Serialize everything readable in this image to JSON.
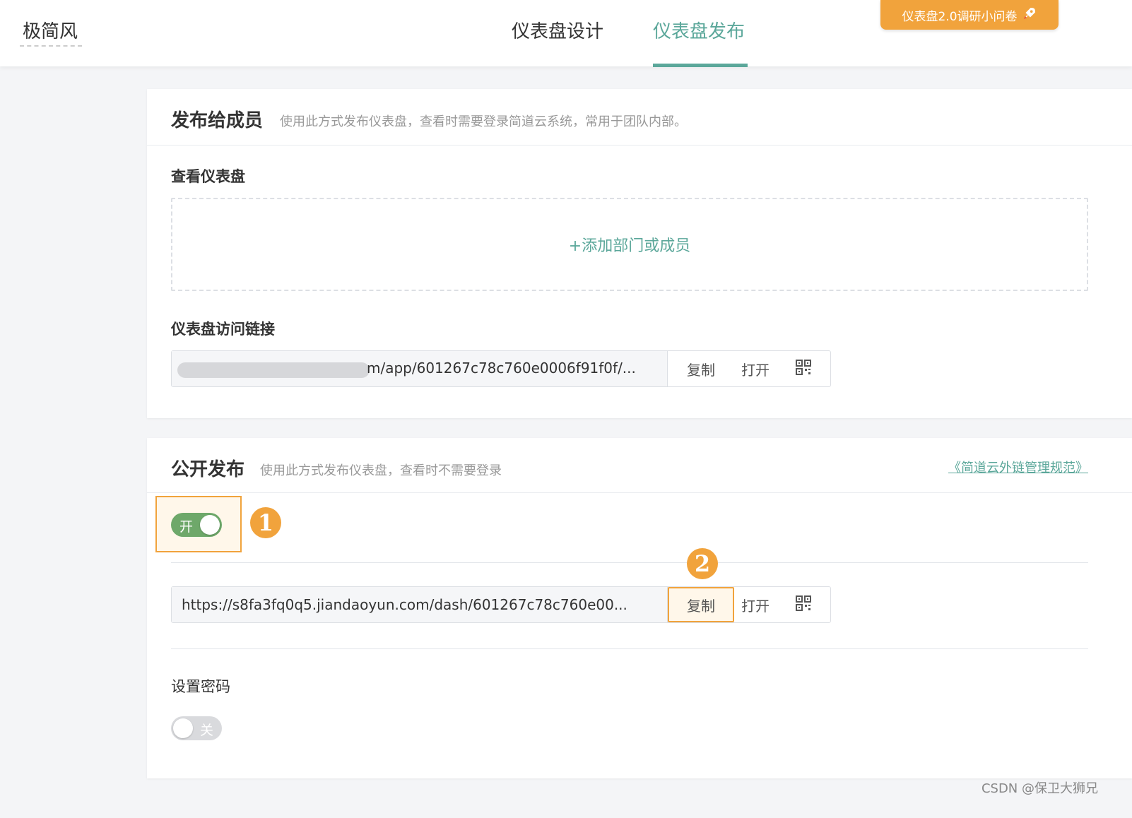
{
  "header": {
    "brand": "极简风",
    "tabs": [
      {
        "label": "仪表盘设计",
        "active": false
      },
      {
        "label": "仪表盘发布",
        "active": true
      }
    ],
    "survey_button": "仪表盘2.0调研小问卷",
    "accent_color": "#5ba79a"
  },
  "members_section": {
    "title": "发布给成员",
    "description": "使用此方式发布仪表盘，查看时需要登录简道云系统，常用于团队内部。",
    "view_label": "查看仪表盘",
    "add_button": "+添加部门或成员",
    "link_label": "仪表盘访问链接",
    "link_value": "m/app/601267c78c760e0006f91f0f/...",
    "copy": "复制",
    "open": "打开",
    "qr_icon": "qr-code-icon"
  },
  "public_section": {
    "title": "公开发布",
    "description": "使用此方式发布仪表盘，查看时不需要登录",
    "rule_link": "《简道云外链管理规范》",
    "toggle_label": "开",
    "badge_1": "1",
    "badge_2": "2",
    "link_value": "https://s8fa3fq0q5.jiandaoyun.com/dash/601267c78c760e00...",
    "copy": "复制",
    "open": "打开",
    "password_label": "设置密码",
    "password_toggle_label": "关",
    "highlight_color": "#f1a33c"
  },
  "watermark": "CSDN @保卫大狮兄"
}
